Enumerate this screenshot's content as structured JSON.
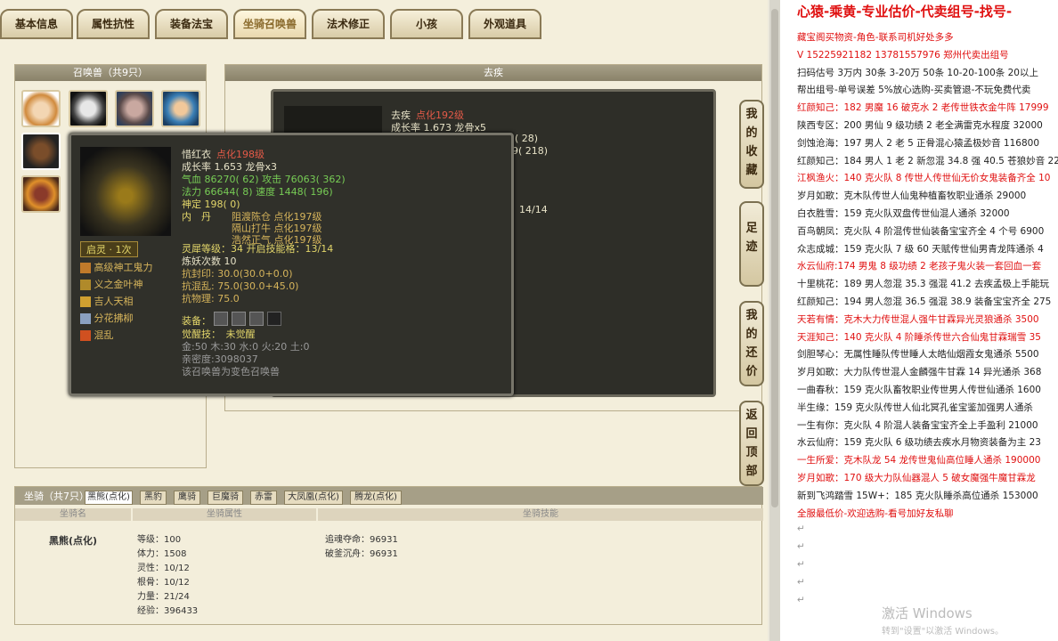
{
  "tabs": [
    "基本信息",
    "属性抗性",
    "装备法宝",
    "坐骑召唤兽",
    "法术修正",
    "小孩",
    "外观道具"
  ],
  "pets_panel": {
    "title": "召唤兽（共9只）"
  },
  "right_panel": {
    "title": "去疾"
  },
  "pet_behind": {
    "name": "去疾",
    "level": "点化192级",
    "growth": "成长率 1.673 龙骨x5",
    "a": "1( 28)",
    "b": "9( 218)",
    "c": "14/14"
  },
  "pet_detail": {
    "name": "惜红衣",
    "level": "点化198级",
    "growth": "成长率 1.653 龙骨x3",
    "hp_label": "气血",
    "hp": "86270( 62)",
    "atk_label": "攻击",
    "atk": "76063( 362)",
    "mp_label": "法力",
    "mp": "66644( 8)",
    "spd_label": "速度",
    "spd": "1448( 196)",
    "shen": "神定 198( 0)",
    "neidan_label": "内　丹",
    "neidan": [
      "阻渡陈仓 点化197级",
      "隔山打牛 点化197级",
      "浩然正气 点化197级"
    ],
    "lingyuan": "灵犀等级：34 开启技能格：13/14",
    "lianyao": "炼妖次数 10",
    "kangfeng": "抗封印: 30.0(30.0+0.0)",
    "kanghun": "抗混乱: 75.0(30.0+45.0)",
    "kangwu": "抗物理: 75.0",
    "equip_label": "装备：",
    "juexing": "觉醒技：　未觉醒",
    "elements": "金:50 木:30 水:0 火:20 土:0",
    "qinmi": "亲密度:3098037",
    "note": "该召唤兽为变色召唤兽",
    "qiling": "启灵 · 1次",
    "skills": [
      "高级神工鬼力",
      "义之金叶神",
      "吉人天相",
      "分花拂柳",
      "混乱"
    ]
  },
  "side_buttons": [
    "我的收藏",
    "足迹",
    "我的还价",
    "返回顶部"
  ],
  "mount": {
    "count_label": "坐骑（共7只）",
    "tabs": [
      "黑熊(点化)",
      "黑豹",
      "鹰骑",
      "巨魔骑",
      "赤雷",
      "大凤凰(点化)",
      "腾龙(点化)"
    ],
    "headers": [
      "坐骑名",
      "坐骑属性",
      "坐骑技能"
    ],
    "name": "黑熊(点化)",
    "stats": [
      "等级：100",
      "体力：1508",
      "灵性：10/12",
      "根骨：10/12",
      "力量：21/24",
      "经验：396433"
    ],
    "skills": [
      "追魂夺命：96931",
      "破釜沉舟：96931"
    ]
  },
  "doc": {
    "title": "心猿-乘黄-专业估价-代卖组号-找号-",
    "lines": [
      {
        "t": "藏宝阁买物资-角色-联系司机好处多多",
        "r": true
      },
      {
        "t": "V 15225921182  13781557976  郑州代卖出组号",
        "r": true
      },
      {
        "t": "扫码估号 3万内 30条  3-20万 50条  10-20-100条  20以上",
        "r": false
      },
      {
        "t": "帮出组号-单号误差 5%放心选购-买卖管退-不玩免费代卖",
        "r": false
      },
      {
        "t": "红颜知己：182 男魔 16 破克水 2 老传世铁衣金牛阵 17999",
        "r": true
      },
      {
        "t": "陕西专区：200 男仙 9 级功绩 2 老全满雷克水程度 32000",
        "r": false
      },
      {
        "t": "剑蚀沧海：197 男人 2 老 5 正骨混心猿孟极妙音 116800",
        "r": false
      },
      {
        "t": "红颜知己：184 男人 1 老 2 新忽混 34.8 强 40.5 苍狼妙音 22",
        "r": false
      },
      {
        "t": "江枫渔火：140 克火队 8 传世人传世仙无价女鬼装备齐全 10",
        "r": true
      },
      {
        "t": "岁月如歌：克木队传世人仙鬼种植畜牧职业通杀 29000",
        "r": false
      },
      {
        "t": "白衣胜雪：159 克火队双盘传世仙混人通杀 32000",
        "r": false
      },
      {
        "t": "百鸟朝凤：克火队 4 阶混传世仙装备宝宝齐全 4 个号 6900",
        "r": false
      },
      {
        "t": "众志成城：159 克火队 7 级 60 天赋传世仙男青龙阵通杀 4",
        "r": false
      },
      {
        "t": "水云仙府:174 男鬼 8 级功绩 2 老孩子鬼火装一套回血一套",
        "r": true
      },
      {
        "t": "十里桃花：189 男人忽混 35.3 强混 41.2 去疾孟极上手能玩",
        "r": false
      },
      {
        "t": "红颜知己：194 男人忽混 36.5 强混 38.9 装备宝宝齐全 275",
        "r": false
      },
      {
        "t": "天若有情：克木大力传世混人强牛甘霖异光灵狼通杀 3500",
        "r": true
      },
      {
        "t": "天涯知己：140 克火队 4 阶睡杀传世六合仙鬼甘霖瑞雪 35",
        "r": true
      },
      {
        "t": "剑胆琴心：无属性睡队传世睡人太皓仙烟霞女鬼通杀 5500",
        "r": false
      },
      {
        "t": "岁月如歌：大力队传世混人金麟强牛甘霖 14 异光通杀 368",
        "r": false
      },
      {
        "t": "一曲春秋：159 克火队畜牧职业传世男人传世仙通杀 1600",
        "r": false
      },
      {
        "t": "半生缘：159 克火队传世人仙北冥孔雀宝鉴加强男人通杀",
        "r": false
      },
      {
        "t": "一生有你：克火队 4 阶混人装备宝宝齐全上手盈利 21000",
        "r": false
      },
      {
        "t": "水云仙府：159 克火队 6 级功绩去疾水月物资装备为主 23",
        "r": false
      },
      {
        "t": "一生所爱：克木队龙 54 龙传世鬼仙高位睡人通杀 190000",
        "r": true
      },
      {
        "t": "岁月如歌：170 级大力队仙器混人 5 破女魔强牛魔甘霖龙",
        "r": true
      },
      {
        "t": "新到飞鸿踏雪 15W+：185 克火队睡杀高位通杀 153000",
        "r": false
      },
      {
        "t": "全服最低价-欢迎选购-看号加好友私聊",
        "r": true
      }
    ],
    "watermark1": "激活 Windows",
    "watermark2": "转到\"设置\"以激活 Windows。"
  },
  "colors": {
    "accent_red": "#e01010",
    "panel_bg": "#f3eedb",
    "popup_bg": "#30302a"
  }
}
